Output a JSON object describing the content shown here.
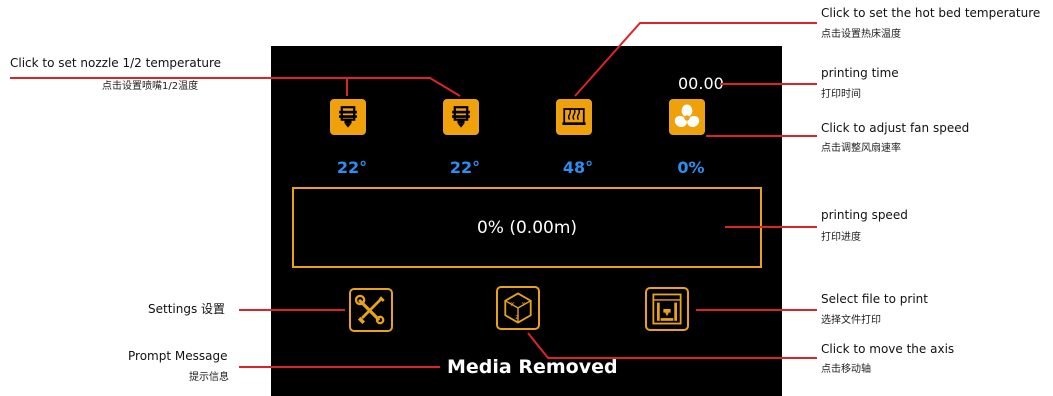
{
  "annotations": {
    "nozzle": {
      "en": "Click to set nozzle 1/2 temperature",
      "cn": "点击设置喷嘴1/2温度"
    },
    "hotbed": {
      "en": "Click to set the hot bed temperature",
      "cn": "点击设置热床温度"
    },
    "printing_time": {
      "en": "printing time",
      "cn": "打印时间"
    },
    "fan": {
      "en": "Click to adjust fan speed",
      "cn": "点击调整风扇速率"
    },
    "speed": {
      "en": "printing speed",
      "cn": "打印进度"
    },
    "settings": {
      "en": "Settings 设置"
    },
    "select_file": {
      "en": "Select file to print",
      "cn": "选择文件打印"
    },
    "prompt": {
      "en": "Prompt Message",
      "cn": "提示信息"
    },
    "move_axis": {
      "en": "Click to move the axis",
      "cn": "点击移动轴"
    }
  },
  "screen": {
    "time": "00.00",
    "nozzle1_temp": "22°",
    "nozzle2_temp": "22°",
    "bed_temp": "48°",
    "fan_speed": "0%",
    "progress_text": "0%  (0.00m)",
    "prompt_message": "Media Removed"
  },
  "icons": {
    "nozzle1": "nozzle-icon",
    "nozzle2": "nozzle-icon",
    "bed": "hot-bed-icon",
    "fan": "fan-icon",
    "settings": "wrench-screwdriver-icon",
    "axis": "xyz-cube-icon",
    "file": "printer-file-icon"
  },
  "colors": {
    "accent": "#e8a317",
    "icon_fill": "#f0a10a",
    "temp_text": "#2a8ff0",
    "callout_line": "#d9252a",
    "screen_bg": "#000000"
  }
}
